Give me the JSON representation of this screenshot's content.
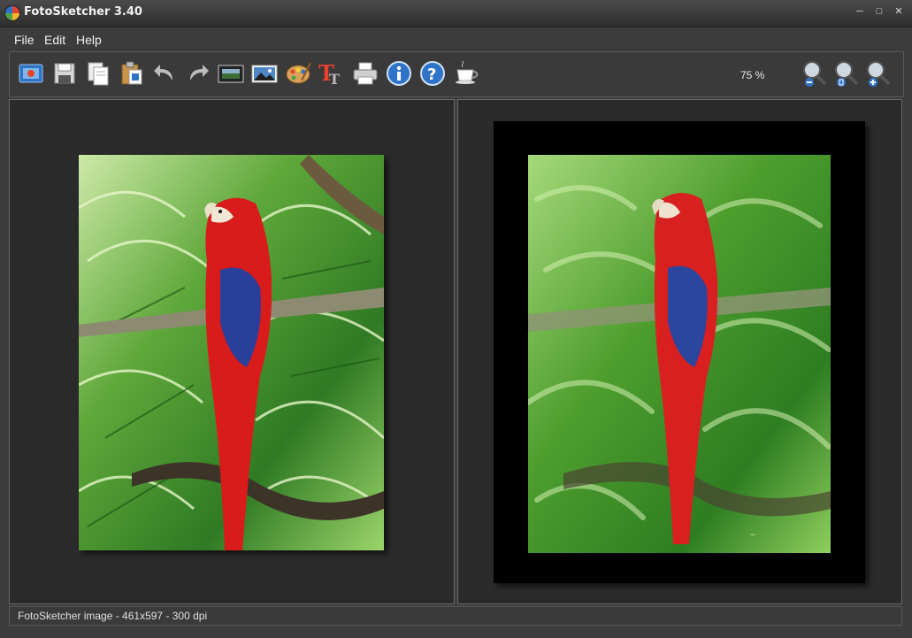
{
  "window": {
    "title": "FotoSketcher 3.40"
  },
  "menu": {
    "items": [
      "File",
      "Edit",
      "Help"
    ]
  },
  "toolbar": {
    "icons": [
      "open-image-icon",
      "save-icon",
      "copy-icon",
      "paste-icon",
      "undo-icon",
      "redo-icon",
      "filmstrip-icon",
      "landscape-photo-icon",
      "palette-icon",
      "text-icon",
      "print-icon",
      "info-icon",
      "help-icon",
      "coffee-cup-icon"
    ],
    "zoom": "75 %",
    "zoom_icons": [
      "zoom-out-icon",
      "zoom-fit-icon",
      "zoom-in-icon"
    ]
  },
  "status": {
    "text": "FotoSketcher image - 461x597 - 300 dpi"
  },
  "colors": {
    "accent": "#2e73c8",
    "parrot_red": "#d81c1c",
    "parrot_blue": "#2a3f9a",
    "leaf_green": "#3f9a2c"
  }
}
